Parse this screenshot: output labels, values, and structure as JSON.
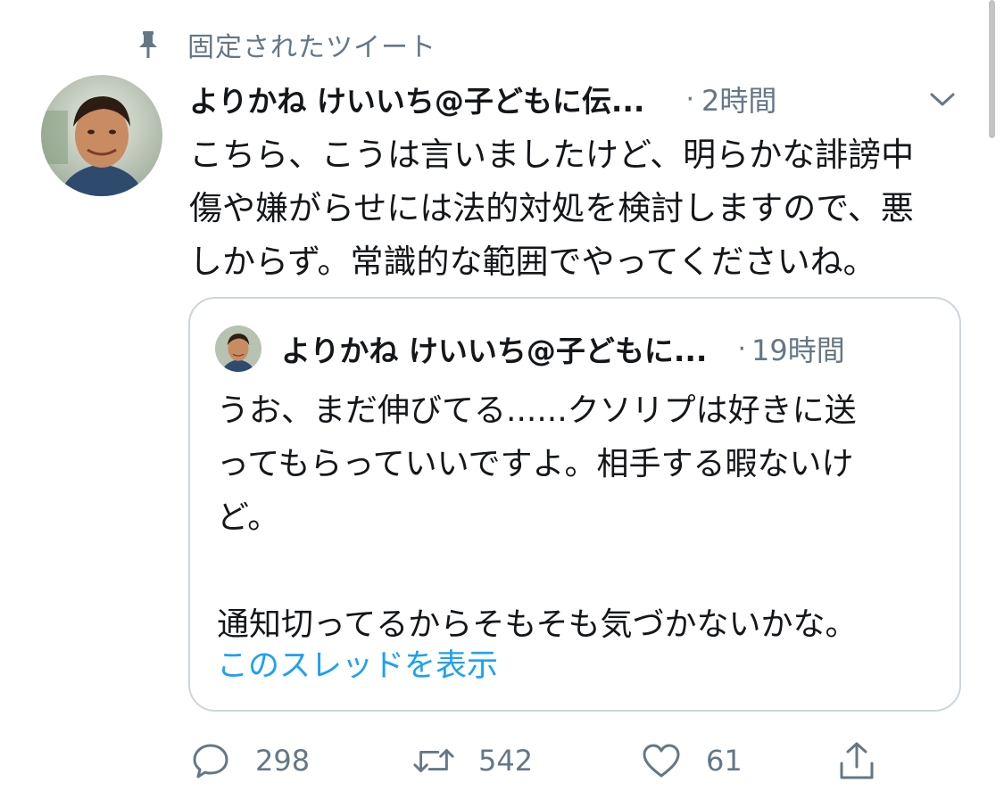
{
  "pinned": {
    "label": "固定されたツイート",
    "icon": "pin-icon"
  },
  "tweet": {
    "display_name": "よりかね けいいち@子どもに伝...",
    "separator": "·",
    "time": "2時間",
    "text_lines": [
      "こちら、こうは言いましたけど、明らかな誹謗中",
      "傷や嫌がらせには法的対処を検討しますので、悪",
      "しからず。常識的な範囲でやってくださいね。"
    ]
  },
  "quote": {
    "display_name": "よりかね けいいち@子どもに...",
    "separator": "·",
    "time": "19時間",
    "text_lines": [
      "うお、まだ伸びてる......クソリプは好きに送",
      "ってもらっていいですよ。相手する暇ないけ",
      "ど。",
      "",
      "通知切ってるからそもそも気づかないかな。"
    ],
    "show_thread": "このスレッドを表示"
  },
  "actions": {
    "reply_count": "298",
    "retweet_count": "542",
    "like_count": "61"
  },
  "colors": {
    "link": "#1da1f2",
    "secondary": "#657786",
    "border": "#ccd6dd"
  }
}
